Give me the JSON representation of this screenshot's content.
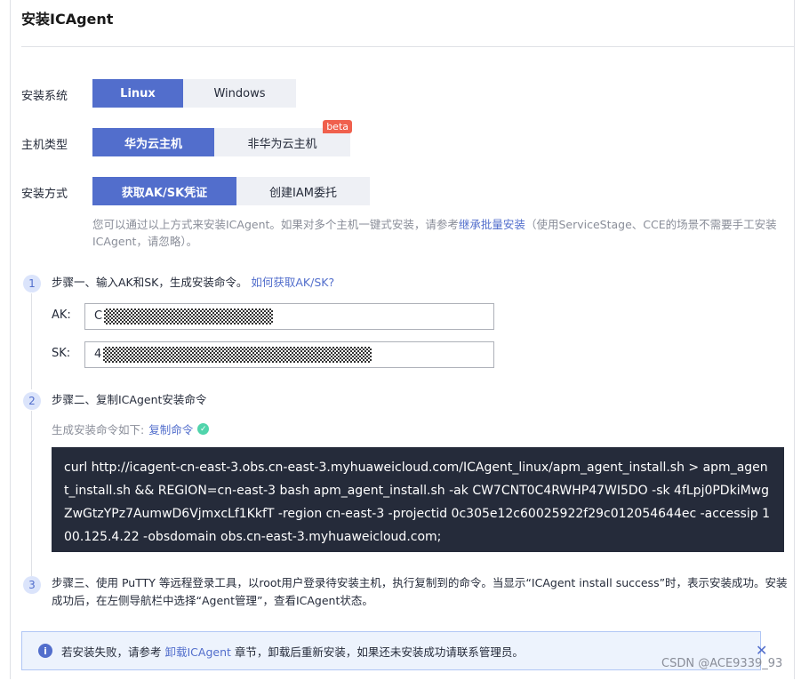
{
  "panel": {
    "title": "安装ICAgent"
  },
  "os_row": {
    "label": "安装系统",
    "options": [
      "Linux",
      "Windows"
    ],
    "selected": "Linux"
  },
  "host_row": {
    "label": "主机类型",
    "options": [
      "华为云主机",
      "非华为云主机"
    ],
    "selected": "华为云主机",
    "badge": "beta"
  },
  "method_row": {
    "label": "安装方式",
    "options": [
      "获取AK/SK凭证",
      "创建IAM委托"
    ],
    "selected": "获取AK/SK凭证"
  },
  "note": {
    "prefix": "您可以通过以上方式来安装ICAgent。如果对多个主机一键式安装，请参考",
    "link": "继承批量安装",
    "suffix": "（使用ServiceStage、CCE的场景不需要手工安装ICAgent，请忽略）。"
  },
  "step1": {
    "num": "1",
    "text": "步骤一、输入AK和SK，生成安装命令。",
    "link": "如何获取AK/SK?"
  },
  "ak": {
    "label": "AK:",
    "value_visible": "C"
  },
  "sk": {
    "label": "SK:",
    "value_visible": "4"
  },
  "step2": {
    "num": "2",
    "text": "步骤二、复制ICAgent安装命令"
  },
  "command": {
    "label": "生成安装命令如下:",
    "copy_link": "复制命令",
    "text": "curl http://icagent-cn-east-3.obs.cn-east-3.myhuaweicloud.com/ICAgent_linux/apm_agent_install.sh > apm_agent_install.sh && REGION=cn-east-3 bash apm_agent_install.sh -ak CW7CNT0C4RWHP47WI5DO -sk 4fLpj0PDkiMwgZwGtzYPz7AumwD6VjmxcLf1KkfT -region cn-east-3 -projectid 0c305e12c60025922f29c012054644ec -accessip 100.125.4.22 -obsdomain obs.cn-east-3.myhuaweicloud.com;"
  },
  "step3": {
    "num": "3",
    "text": "步骤三、使用 PuTTY 等远程登录工具，以root用户登录待安装主机，执行复制到的命令。当显示“ICAgent install success”时，表示安装成功。安装成功后，在左侧导航栏中选择“Agent管理”，查看ICAgent状态。"
  },
  "alert": {
    "prefix": "若安装失败，请参考",
    "link": "卸载ICAgent",
    "suffix": "章节，卸载后重新安装，如果还未安装成功请联系管理员。",
    "close": "✕"
  },
  "watermark": "CSDN @ACE9339_93",
  "colors": {
    "accent": "#526ecc",
    "badge": "#f0604d",
    "code_bg": "#252b3a"
  }
}
